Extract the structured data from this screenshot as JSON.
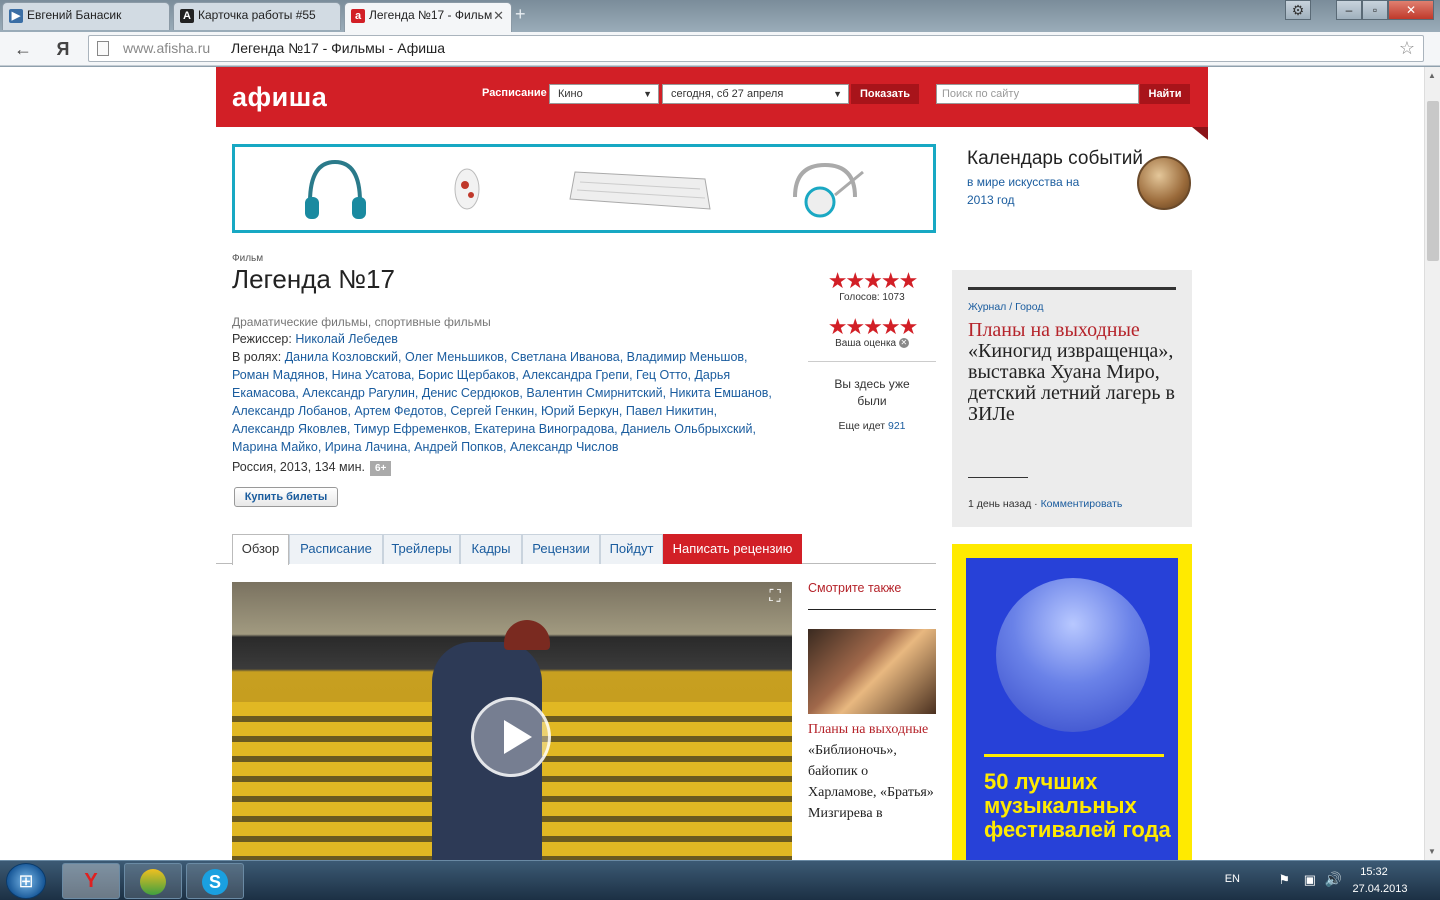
{
  "browser": {
    "tabs": [
      {
        "title": "Евгений Банасик",
        "icon": "video-favicon-icon"
      },
      {
        "title": "Карточка работы #55",
        "icon": "a-favicon-icon"
      },
      {
        "title": "Легенда №17 - Фильм",
        "icon": "afisha-favicon-icon"
      }
    ],
    "url_domain": "www.afisha.ru",
    "url_title": "Легенда №17 - Фильмы - Афиша",
    "ya": "Я"
  },
  "header": {
    "logo": "афиша",
    "schedule_label": "Расписание",
    "category_value": "Кино",
    "date_value": "сегодня, сб 27 апреля",
    "show_button": "Показать",
    "search_placeholder": "Поиск по сайту",
    "find_button": "Найти"
  },
  "calendar": {
    "title": "Календарь событий",
    "subtitle": "в мире искусства на 2013 год"
  },
  "film": {
    "kind": "Фильм",
    "title": "Легенда №17",
    "genres": "Драматические фильмы, спортивные фильмы",
    "director_label": "Режиссер:",
    "director": "Николай Лебедев",
    "cast_label": "В ролях:",
    "cast": "Данила Козловский, Олег Меньшиков, Светлана Иванова, Владимир Меньшов, Роман Мадянов, Нина Усатова, Борис Щербаков, Александра Грепи, Гец Отто, Дарья Екамасова, Александр Рагулин, Денис Сердюков, Валентин Смирнитский, Никита Емшанов, Александр Лобанов, Артем Федотов, Сергей Генкин, Юрий Беркун, Павел Никитин, Александр Яковлев, Тимур Ефременков, Екатерина Виноградова, Даниель Ольбрыхский, Марина Майко, Ирина Лачина, Андрей Попков, Александр Числов",
    "country_year": "Россия, 2013, 134 мин.",
    "age": "6+",
    "buy_button": "Купить билеты"
  },
  "rating": {
    "stars": "★★★★★",
    "votes": "Голосов: 1073",
    "your_stars": "★★★★★",
    "your_label": "Ваша оценка",
    "been_text": "Вы здесь уже были",
    "going_label": "Еще идет",
    "going_count": "921"
  },
  "tabs": [
    "Обзор",
    "Расписание",
    "Трейлеры",
    "Кадры",
    "Рецензии",
    "Пойдут",
    "Написать рецензию"
  ],
  "see_also": {
    "title": "Смотрите также",
    "link": "Планы на выходные",
    "text": "«Библионочь», байопик о Харламове, «Братья» Мизгирева в"
  },
  "journal": {
    "crumb1": "Журнал",
    "sep": " / ",
    "crumb2": "Город",
    "headline_red": "Планы на выходные",
    "headline": "«Киногид извращенца», выставка Хуана Миро, детский летний лагерь в ЗИЛе",
    "time": "1 день назад",
    "dot": " · ",
    "comment": "Комментировать"
  },
  "ad": {
    "text": "50 лучших музыкальных фестивалей года"
  },
  "taskbar": {
    "lang": "EN",
    "time": "15:32",
    "date": "27.04.2013"
  }
}
